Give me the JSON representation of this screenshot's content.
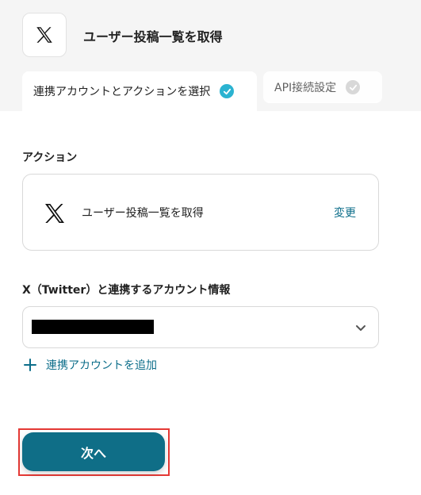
{
  "page": {
    "title": "ユーザー投稿一覧を取得"
  },
  "tabs": [
    {
      "label": "連携アカウントとアクションを選択",
      "state": "active",
      "completed": true
    },
    {
      "label": "API接続設定",
      "state": "inactive",
      "completed": false
    }
  ],
  "action_section": {
    "label": "アクション",
    "action_name": "ユーザー投稿一覧を取得",
    "change_label": "変更",
    "icon": "x-logo-icon"
  },
  "account_section": {
    "label": "X（Twitter）と連携するアカウント情報",
    "selected_value_redacted": true,
    "add_account_label": "連携アカウントを追加"
  },
  "footer": {
    "next_label": "次へ"
  },
  "colors": {
    "accent": "#0f6e87",
    "link": "#0d6e8a",
    "check_active": "#2bb3d1",
    "highlight_border": "#e53935"
  }
}
